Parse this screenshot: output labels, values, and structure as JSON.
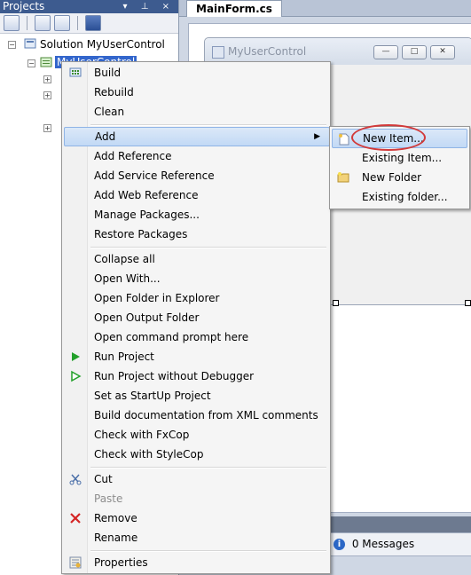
{
  "projects_panel": {
    "title": "Projects",
    "pin_glyph": "▾ ⊥ ×",
    "tree": {
      "solution_label": "Solution MyUserControl",
      "project_label": "MyUserControl"
    }
  },
  "document": {
    "tab_label": "MainForm.cs",
    "form_title": "MyUserControl",
    "minimize_glyph": "—",
    "maximize_glyph": "□",
    "close_glyph": "✕"
  },
  "status": {
    "messages_label": "0 Messages",
    "info_glyph": "i"
  },
  "context_menu": {
    "build": "Build",
    "rebuild": "Rebuild",
    "clean": "Clean",
    "add": "Add",
    "add_arrow": "▶",
    "add_reference": "Add Reference",
    "add_service_reference": "Add Service Reference",
    "add_web_reference": "Add Web Reference",
    "manage_packages": "Manage Packages...",
    "restore_packages": "Restore Packages",
    "collapse_all": "Collapse all",
    "open_with": "Open With...",
    "open_folder": "Open Folder in Explorer",
    "open_output_folder": "Open Output Folder",
    "open_command_prompt": "Open command prompt here",
    "run_project": "Run Project",
    "run_without_debugger": "Run Project without Debugger",
    "set_startup": "Set as StartUp Project",
    "build_documentation": "Build documentation from XML comments",
    "check_fxcop": "Check with FxCop",
    "check_stylecop": "Check with StyleCop",
    "cut": "Cut",
    "paste": "Paste",
    "remove": "Remove",
    "rename": "Rename",
    "properties": "Properties"
  },
  "add_submenu": {
    "new_item": "New Item...",
    "existing_item": "Existing Item...",
    "new_folder": "New Folder",
    "existing_folder": "Existing folder..."
  },
  "colors": {
    "highlight": "#c2d9f5",
    "annotation_ring": "#d23a3a",
    "panel_title": "#3d5b8f"
  }
}
